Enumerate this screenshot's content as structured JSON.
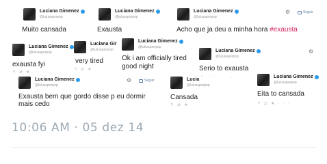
{
  "tweets": [
    {
      "name": "Luciana Gimenez",
      "handle": "@lulusuperpop",
      "text": "Muito cansada"
    },
    {
      "name": "Luciana Gimenez",
      "handle": "@lulusuperpop",
      "text": "Exausta"
    },
    {
      "name": "Luciana Gimenez",
      "handle": "@lulusuperpop",
      "text": "Acho que ja deu a minha hora ",
      "hashtag": "#exausta"
    },
    {
      "name": "Luciana Gimenez",
      "handle": "@lulusuperpop",
      "text": "exausta fyi"
    },
    {
      "name": "Luciana Gir",
      "handle": "@lulusuperpop",
      "text": "very tired"
    },
    {
      "name": "Luciana Gimenez",
      "handle": "@lulusuperpop",
      "text": "Ok i am officially tired",
      "text2": "good night"
    },
    {
      "name": "Luciana Gimenez",
      "handle": "@lulusuperpop",
      "text": "Serio to  exausta"
    },
    {
      "name": "Luciana Gimenez",
      "handle": "@lulusuperpop",
      "text": "Exausta bem que gordo disse p eu dormir",
      "text2": "mais cedo"
    },
    {
      "name": "Lucia",
      "handle": "@lulusuperpop",
      "text": "Cansada"
    },
    {
      "name": "Luciana Gimenez",
      "handle": "@lulusuperpop",
      "text": "Eita to cansada"
    }
  ],
  "follow_label": "Seguir",
  "icons": {
    "gear": "gear-icon",
    "follow": "follow-person-icon",
    "verified": "verified-badge-icon",
    "reply": "reply-icon",
    "retweet": "retweet-icon",
    "like": "like-icon",
    "more": "more-icon"
  },
  "actions": {
    "reply": "↰",
    "retweet": "⇄",
    "like": "★",
    "more": "···"
  },
  "timestamp": "10:06 AM · 05 dez 14",
  "colors": {
    "verified": "#2b9ae8",
    "hashtag": "#d6255d",
    "timestamp": "#9eaab4"
  }
}
